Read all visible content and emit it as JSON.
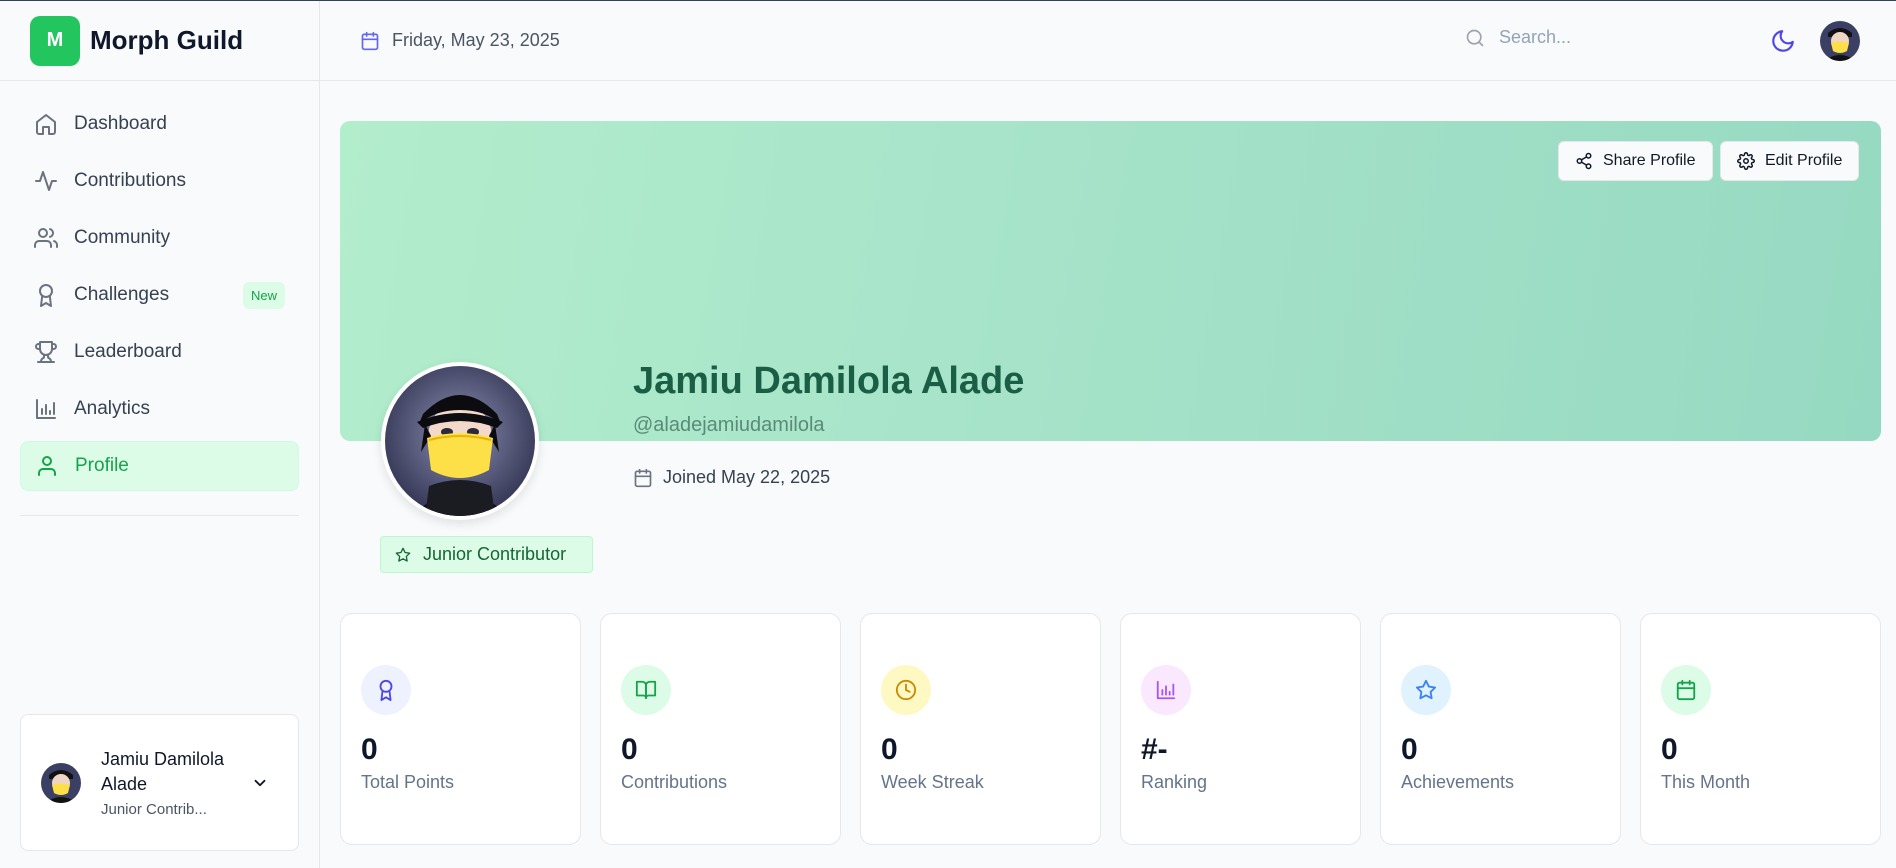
{
  "app": {
    "logo_letter": "M",
    "name": "Morph Guild"
  },
  "header": {
    "date": "Friday, May 23, 2025",
    "search_placeholder": "Search..."
  },
  "sidebar": {
    "items": [
      {
        "label": "Dashboard",
        "icon": "home-icon"
      },
      {
        "label": "Contributions",
        "icon": "activity-icon"
      },
      {
        "label": "Community",
        "icon": "users-icon"
      },
      {
        "label": "Challenges",
        "icon": "award-icon",
        "badge": "New"
      },
      {
        "label": "Leaderboard",
        "icon": "trophy-icon"
      },
      {
        "label": "Analytics",
        "icon": "bar-chart-icon"
      },
      {
        "label": "Profile",
        "icon": "user-icon",
        "active": true
      }
    ],
    "user": {
      "name": "Jamiu Damilola Alade",
      "role": "Junior Contrib..."
    }
  },
  "profile": {
    "share_label": "Share Profile",
    "edit_label": "Edit Profile",
    "name": "Jamiu Damilola Alade",
    "handle": "@aladejamiudamilola",
    "joined": "Joined May 22, 2025",
    "rank": "Junior Contributor"
  },
  "stats": [
    {
      "value": "0",
      "label": "Total Points",
      "icon": "award-icon",
      "bg": "#eef2ff",
      "fg": "#4f46e5"
    },
    {
      "value": "0",
      "label": "Contributions",
      "icon": "book-open-icon",
      "bg": "#dcfce7",
      "fg": "#16a34a"
    },
    {
      "value": "0",
      "label": "Week Streak",
      "icon": "clock-icon",
      "bg": "#fef9c3",
      "fg": "#ca8a04"
    },
    {
      "value": "#-",
      "label": "Ranking",
      "icon": "bar-chart-icon",
      "bg": "#fae8ff",
      "fg": "#a855f7"
    },
    {
      "value": "0",
      "label": "Achievements",
      "icon": "star-icon",
      "bg": "#e0f2fe",
      "fg": "#3b82f6"
    },
    {
      "value": "0",
      "label": "This Month",
      "icon": "calendar-icon",
      "bg": "#dcfce7",
      "fg": "#16a34a"
    }
  ],
  "colors": {
    "accent": "#22c55e",
    "banner_start": "#b2edcc",
    "banner_end": "#96d9c2",
    "name_color": "#1a5e46"
  }
}
